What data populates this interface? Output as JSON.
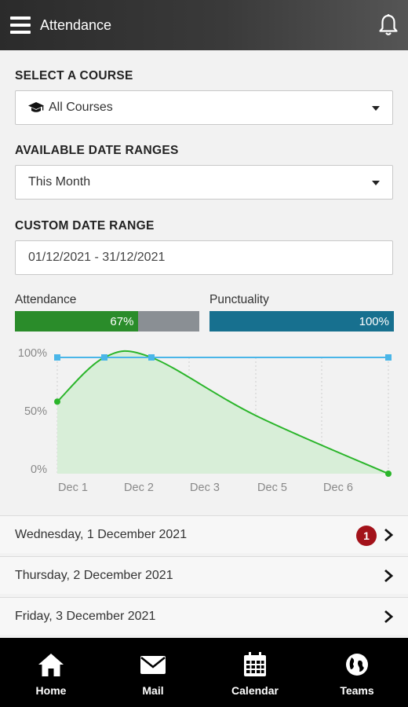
{
  "header": {
    "title": "Attendance",
    "menu_icon": "hamburger-menu-icon",
    "notification_icon": "bell-icon"
  },
  "course": {
    "label": "SELECT A COURSE",
    "value": "All Courses",
    "icon": "graduation-cap-icon"
  },
  "date_ranges": {
    "label": "AVAILABLE DATE RANGES",
    "value": "This Month"
  },
  "custom_range": {
    "label": "CUSTOM DATE RANGE",
    "value": "01/12/2021 - 31/12/2021"
  },
  "stats": {
    "attendance": {
      "label": "Attendance",
      "value_text": "67%",
      "value": 67,
      "color": "#2a8c2a",
      "track_color": "#8a8f94"
    },
    "punctuality": {
      "label": "Punctuality",
      "value_text": "100%",
      "value": 100,
      "color": "#17708f"
    }
  },
  "chart_data": {
    "type": "line",
    "categories": [
      "Dec 1",
      "Dec 2",
      "Dec 3",
      "Dec 5",
      "Dec 6"
    ],
    "y_ticks": [
      "100%",
      "50%",
      "0%"
    ],
    "ylim": [
      0,
      100
    ],
    "series": [
      {
        "color": "#2ab52a",
        "fill": "#d8eed8",
        "values": [
          62,
          100,
          100,
          50,
          0
        ]
      },
      {
        "color": "#4ab6e8",
        "values": [
          100,
          100,
          100,
          100,
          100
        ]
      }
    ],
    "grid": true
  },
  "days": [
    {
      "label": "Wednesday, 1 December 2021",
      "badge": "1"
    },
    {
      "label": "Thursday, 2 December 2021",
      "badge": null
    },
    {
      "label": "Friday, 3 December 2021",
      "badge": null
    }
  ],
  "nav": [
    {
      "label": "Home",
      "icon": "home-icon"
    },
    {
      "label": "Mail",
      "icon": "mail-icon"
    },
    {
      "label": "Calendar",
      "icon": "calendar-icon"
    },
    {
      "label": "Teams",
      "icon": "globe-icon"
    }
  ]
}
